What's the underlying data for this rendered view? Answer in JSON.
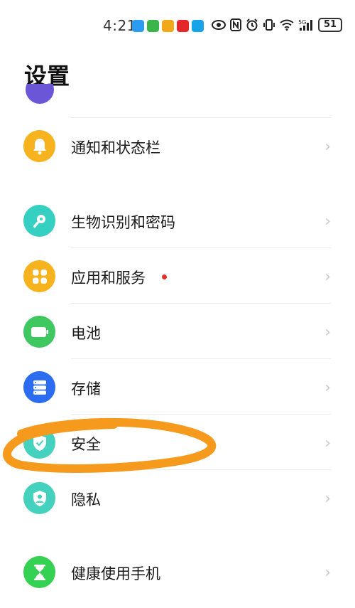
{
  "status_bar": {
    "time": "4:21",
    "battery": "51",
    "notification_icons": [
      {
        "name": "message-icon",
        "color": "#2b9cf2"
      },
      {
        "name": "chat-icon",
        "color": "#3ab54a"
      },
      {
        "name": "weibo-icon",
        "color": "#f3a81a"
      },
      {
        "name": "stock-app-icon",
        "color": "#e5262b"
      },
      {
        "name": "translate-app-icon",
        "color": "#16a3e8"
      }
    ],
    "system_icons": [
      "eye-icon",
      "nfc-icon",
      "alarm-icon",
      "vibrate-icon",
      "wifi-icon",
      "signal-5g-icon"
    ]
  },
  "page_title": "设置",
  "colors": {
    "purple": "#6b56d8",
    "notification": "#f6b31d",
    "biometric": "#36d0c2",
    "apps": "#f6b31d",
    "battery": "#3fc760",
    "storage": "#2b6cf0",
    "security": "#44d1bd",
    "privacy": "#44d1bd",
    "wellbeing": "#35d152",
    "annotation": "#f59a1c"
  },
  "menu": {
    "notification": {
      "label": "通知和状态栏"
    },
    "biometric": {
      "label": "生物识别和密码"
    },
    "apps": {
      "label": "应用和服务"
    },
    "battery": {
      "label": "电池"
    },
    "storage": {
      "label": "存储"
    },
    "security": {
      "label": "安全"
    },
    "privacy": {
      "label": "隐私"
    },
    "wellbeing": {
      "label": "健康使用手机"
    }
  }
}
